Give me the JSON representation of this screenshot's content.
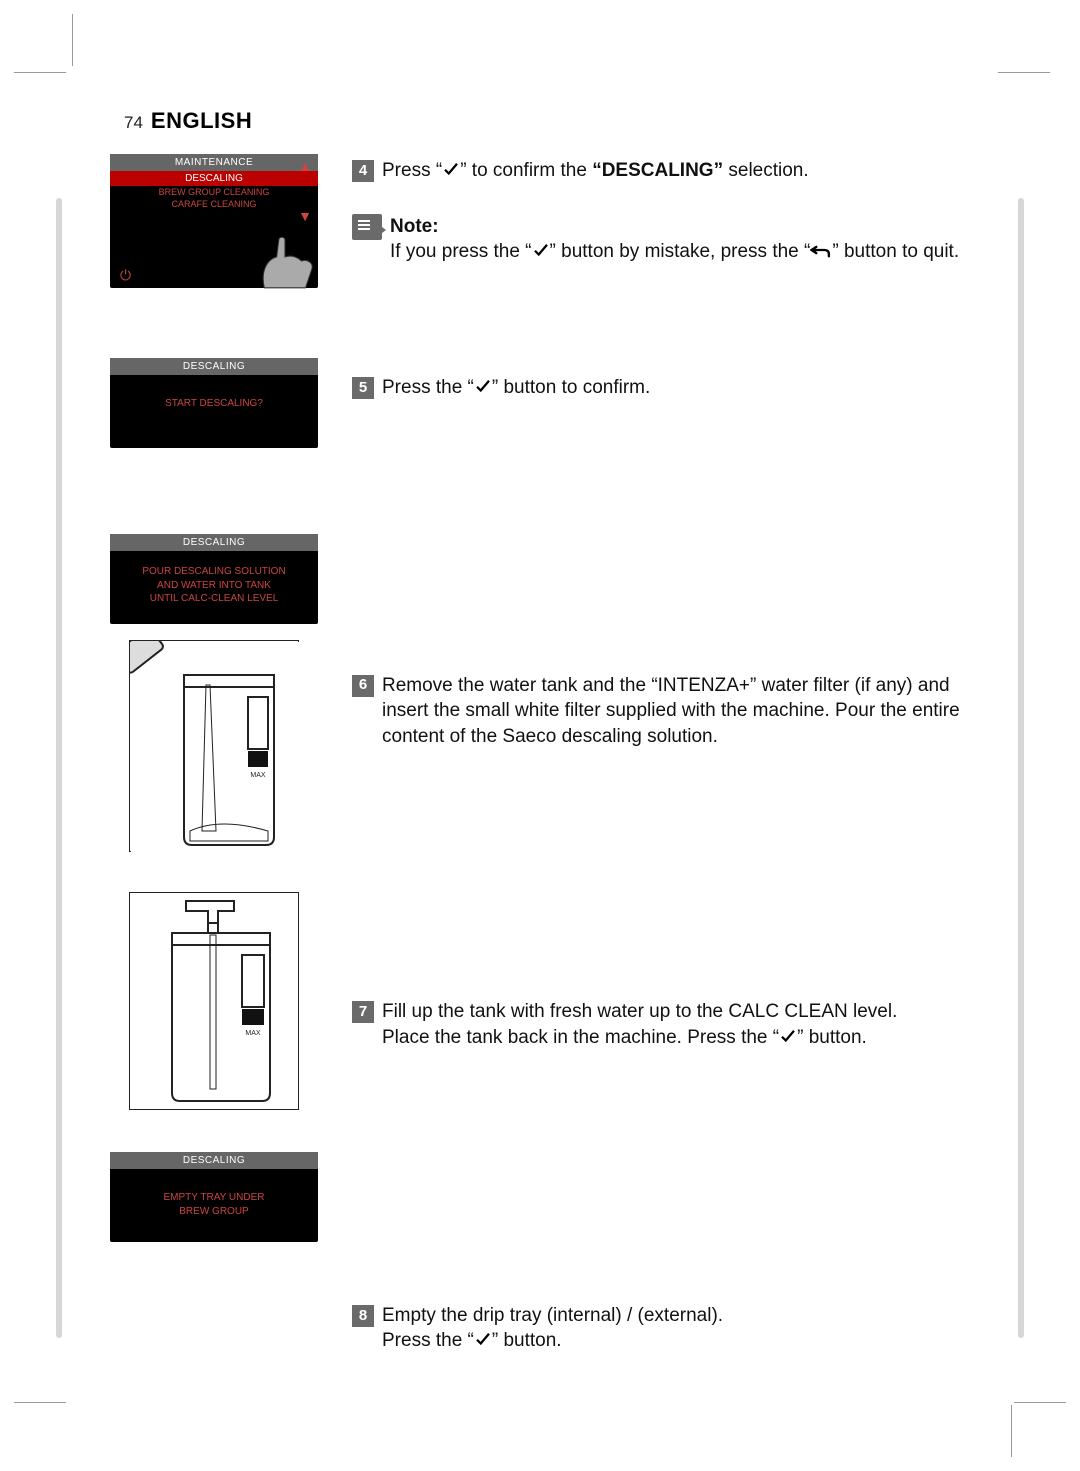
{
  "header": {
    "page_number": "74",
    "language": "ENGLISH"
  },
  "screens": {
    "menu": {
      "title": "MAINTENANCE",
      "selected": "DESCALING",
      "item2": "BREW GROUP CLEANING",
      "item3": "CARAFE CLEANING"
    },
    "confirm": {
      "title": "DESCALING",
      "body": "START DESCALING?"
    },
    "pour": {
      "title": "DESCALING",
      "line1": "POUR DESCALING SOLUTION",
      "line2": "AND WATER INTO TANK",
      "line3": "UNTIL CALC-CLEAN LEVEL"
    },
    "empty": {
      "title": "DESCALING",
      "line1": "EMPTY TRAY UNDER",
      "line2": "BREW GROUP"
    }
  },
  "steps": {
    "s4": {
      "num": "4",
      "pre": " Press “",
      "post": "” to confirm the ",
      "bold": "“DESCALING”",
      "post2": " selection."
    },
    "note": {
      "label": "Note:",
      "pre": "If you press the “",
      "mid": "” button by mistake, press the “",
      "post": "” button to quit."
    },
    "s5": {
      "num": "5",
      "pre": " Press the “",
      "post": "” button to confirm."
    },
    "s6": {
      "num": "6",
      "text": " Remove the water tank and the “INTENZA+” water filter (if any) and insert the small white filter supplied with the machine. Pour the entire content of the Saeco descaling solution."
    },
    "s7": {
      "num": "7",
      "line1": " Fill up the tank with fresh water up to the CALC CLEAN level.",
      "line2_pre": "Place the tank back in the machine. Press the “",
      "line2_post": "” button."
    },
    "s8": {
      "num": "8",
      "line1": " Empty the drip tray (internal) / (external).",
      "line2_pre": "Press the “",
      "line2_post": "” button."
    }
  }
}
